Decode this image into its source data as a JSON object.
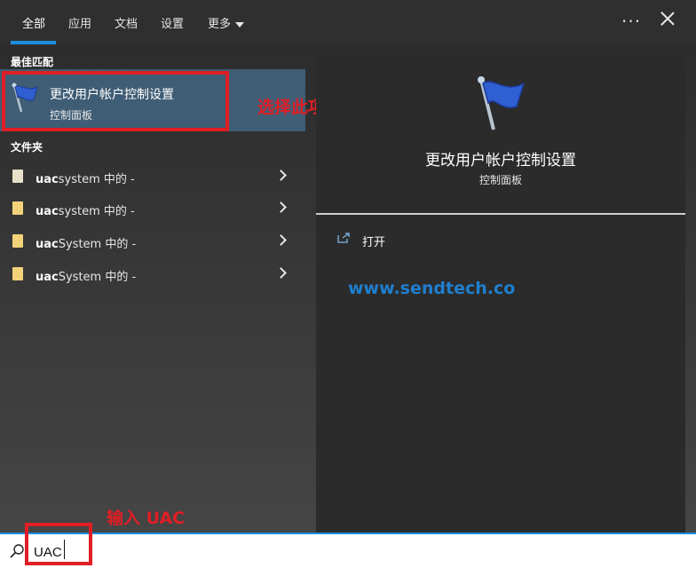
{
  "tabs": [
    {
      "label": "全部",
      "active": true
    },
    {
      "label": "应用"
    },
    {
      "label": "文档"
    },
    {
      "label": "设置"
    },
    {
      "label": "更多"
    }
  ],
  "sections": {
    "best_match": "最佳匹配",
    "folders": "文件夹"
  },
  "best_match": {
    "title": "更改用户帐户控制设置",
    "subtitle": "控制面板",
    "icon": "flag-icon"
  },
  "folders": [
    {
      "bold": "uac",
      "rest": "system 中的 -",
      "icon": "document-icon"
    },
    {
      "bold": "uac",
      "rest": "system 中的 -",
      "icon": "folder-icon"
    },
    {
      "bold": "uac",
      "rest": "System 中的 -",
      "icon": "folder-icon"
    },
    {
      "bold": "uac",
      "rest": "System 中的 -",
      "icon": "folder-icon"
    }
  ],
  "preview": {
    "title": "更改用户帐户控制设置",
    "subtitle": "控制面板",
    "open_label": "打开"
  },
  "watermark": "www.sendtech.co",
  "annotations": {
    "select_item": "选择此项",
    "type_uac": "输入 UAC"
  },
  "search": {
    "value": "UAC"
  },
  "colors": {
    "accent": "#1a8fe0",
    "annotation": "#e01e25",
    "selected_bg": "#3f5d75"
  }
}
